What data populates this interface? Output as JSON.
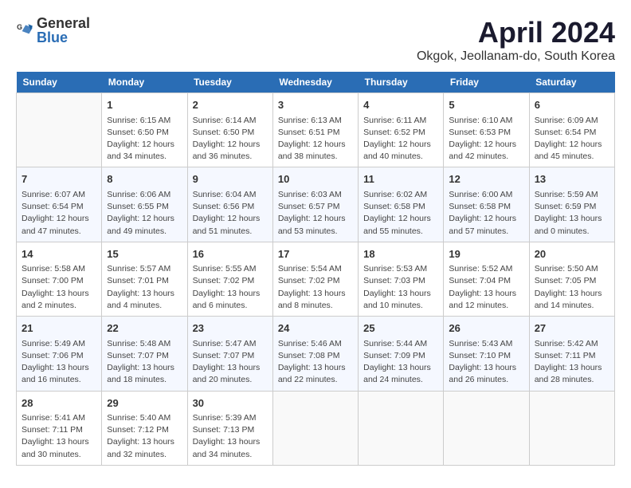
{
  "header": {
    "logo_general": "General",
    "logo_blue": "Blue",
    "month_title": "April 2024",
    "location": "Okgok, Jeollanam-do, South Korea"
  },
  "weekdays": [
    "Sunday",
    "Monday",
    "Tuesday",
    "Wednesday",
    "Thursday",
    "Friday",
    "Saturday"
  ],
  "weeks": [
    [
      {
        "day": "",
        "info": ""
      },
      {
        "day": "1",
        "info": "Sunrise: 6:15 AM\nSunset: 6:50 PM\nDaylight: 12 hours\nand 34 minutes."
      },
      {
        "day": "2",
        "info": "Sunrise: 6:14 AM\nSunset: 6:50 PM\nDaylight: 12 hours\nand 36 minutes."
      },
      {
        "day": "3",
        "info": "Sunrise: 6:13 AM\nSunset: 6:51 PM\nDaylight: 12 hours\nand 38 minutes."
      },
      {
        "day": "4",
        "info": "Sunrise: 6:11 AM\nSunset: 6:52 PM\nDaylight: 12 hours\nand 40 minutes."
      },
      {
        "day": "5",
        "info": "Sunrise: 6:10 AM\nSunset: 6:53 PM\nDaylight: 12 hours\nand 42 minutes."
      },
      {
        "day": "6",
        "info": "Sunrise: 6:09 AM\nSunset: 6:54 PM\nDaylight: 12 hours\nand 45 minutes."
      }
    ],
    [
      {
        "day": "7",
        "info": "Sunrise: 6:07 AM\nSunset: 6:54 PM\nDaylight: 12 hours\nand 47 minutes."
      },
      {
        "day": "8",
        "info": "Sunrise: 6:06 AM\nSunset: 6:55 PM\nDaylight: 12 hours\nand 49 minutes."
      },
      {
        "day": "9",
        "info": "Sunrise: 6:04 AM\nSunset: 6:56 PM\nDaylight: 12 hours\nand 51 minutes."
      },
      {
        "day": "10",
        "info": "Sunrise: 6:03 AM\nSunset: 6:57 PM\nDaylight: 12 hours\nand 53 minutes."
      },
      {
        "day": "11",
        "info": "Sunrise: 6:02 AM\nSunset: 6:58 PM\nDaylight: 12 hours\nand 55 minutes."
      },
      {
        "day": "12",
        "info": "Sunrise: 6:00 AM\nSunset: 6:58 PM\nDaylight: 12 hours\nand 57 minutes."
      },
      {
        "day": "13",
        "info": "Sunrise: 5:59 AM\nSunset: 6:59 PM\nDaylight: 13 hours\nand 0 minutes."
      }
    ],
    [
      {
        "day": "14",
        "info": "Sunrise: 5:58 AM\nSunset: 7:00 PM\nDaylight: 13 hours\nand 2 minutes."
      },
      {
        "day": "15",
        "info": "Sunrise: 5:57 AM\nSunset: 7:01 PM\nDaylight: 13 hours\nand 4 minutes."
      },
      {
        "day": "16",
        "info": "Sunrise: 5:55 AM\nSunset: 7:02 PM\nDaylight: 13 hours\nand 6 minutes."
      },
      {
        "day": "17",
        "info": "Sunrise: 5:54 AM\nSunset: 7:02 PM\nDaylight: 13 hours\nand 8 minutes."
      },
      {
        "day": "18",
        "info": "Sunrise: 5:53 AM\nSunset: 7:03 PM\nDaylight: 13 hours\nand 10 minutes."
      },
      {
        "day": "19",
        "info": "Sunrise: 5:52 AM\nSunset: 7:04 PM\nDaylight: 13 hours\nand 12 minutes."
      },
      {
        "day": "20",
        "info": "Sunrise: 5:50 AM\nSunset: 7:05 PM\nDaylight: 13 hours\nand 14 minutes."
      }
    ],
    [
      {
        "day": "21",
        "info": "Sunrise: 5:49 AM\nSunset: 7:06 PM\nDaylight: 13 hours\nand 16 minutes."
      },
      {
        "day": "22",
        "info": "Sunrise: 5:48 AM\nSunset: 7:07 PM\nDaylight: 13 hours\nand 18 minutes."
      },
      {
        "day": "23",
        "info": "Sunrise: 5:47 AM\nSunset: 7:07 PM\nDaylight: 13 hours\nand 20 minutes."
      },
      {
        "day": "24",
        "info": "Sunrise: 5:46 AM\nSunset: 7:08 PM\nDaylight: 13 hours\nand 22 minutes."
      },
      {
        "day": "25",
        "info": "Sunrise: 5:44 AM\nSunset: 7:09 PM\nDaylight: 13 hours\nand 24 minutes."
      },
      {
        "day": "26",
        "info": "Sunrise: 5:43 AM\nSunset: 7:10 PM\nDaylight: 13 hours\nand 26 minutes."
      },
      {
        "day": "27",
        "info": "Sunrise: 5:42 AM\nSunset: 7:11 PM\nDaylight: 13 hours\nand 28 minutes."
      }
    ],
    [
      {
        "day": "28",
        "info": "Sunrise: 5:41 AM\nSunset: 7:11 PM\nDaylight: 13 hours\nand 30 minutes."
      },
      {
        "day": "29",
        "info": "Sunrise: 5:40 AM\nSunset: 7:12 PM\nDaylight: 13 hours\nand 32 minutes."
      },
      {
        "day": "30",
        "info": "Sunrise: 5:39 AM\nSunset: 7:13 PM\nDaylight: 13 hours\nand 34 minutes."
      },
      {
        "day": "",
        "info": ""
      },
      {
        "day": "",
        "info": ""
      },
      {
        "day": "",
        "info": ""
      },
      {
        "day": "",
        "info": ""
      }
    ]
  ]
}
